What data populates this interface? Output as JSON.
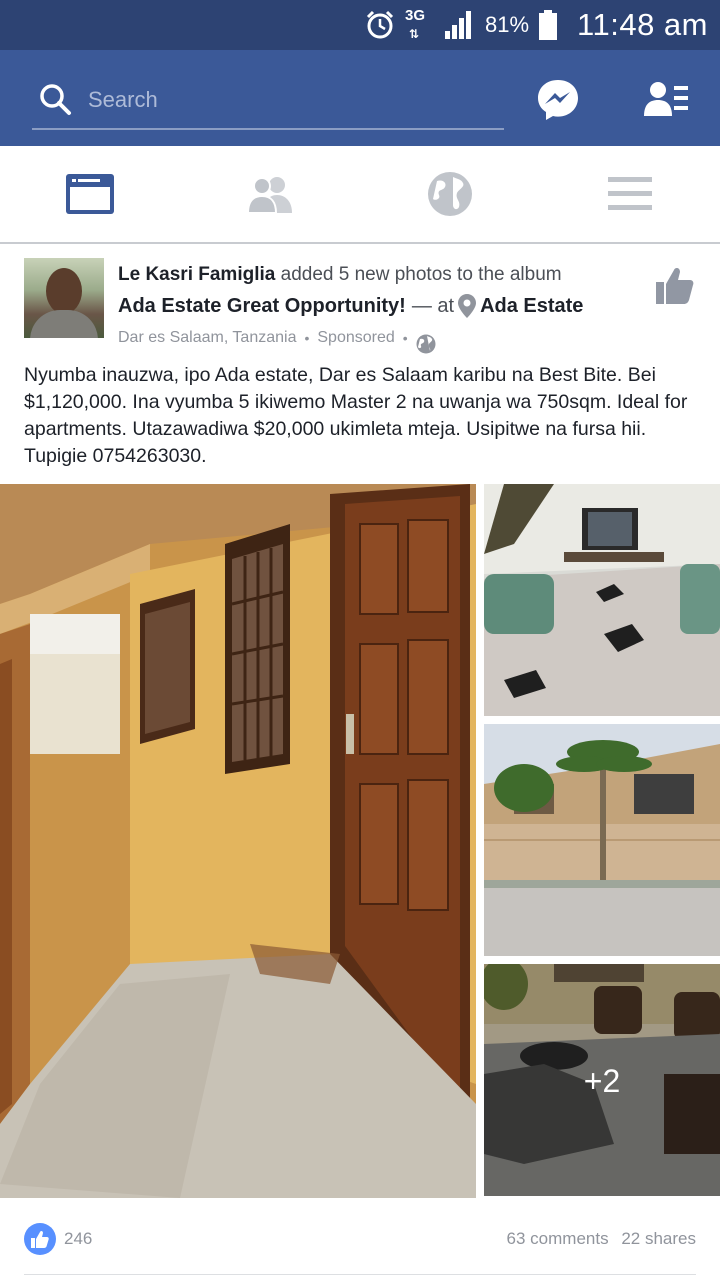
{
  "status_bar": {
    "network": "3G",
    "battery": "81%",
    "time": "11:48 am"
  },
  "app_bar": {
    "search_placeholder": "Search",
    "icons": [
      "search-icon",
      "messenger-icon",
      "friend-requests-icon"
    ]
  },
  "tabs": [
    {
      "name": "news-feed",
      "icon": "news-feed-icon",
      "active": true
    },
    {
      "name": "friends",
      "icon": "friends-icon",
      "active": false
    },
    {
      "name": "notifications",
      "icon": "globe-icon",
      "active": false
    },
    {
      "name": "more",
      "icon": "menu-icon",
      "active": false
    }
  ],
  "post": {
    "author": "Le Kasri Famiglia",
    "action": "added 5 new photos to the album",
    "album": "Ada Estate Great Opportunity!",
    "at_text": "— at",
    "place": "Ada Estate",
    "location": "Dar es Salaam, Tanzania",
    "sponsored": "Sponsored",
    "text": "Nyumba inauzwa, ipo Ada estate, Dar es Salaam karibu na Best Bite. Bei $1,120,000. Ina vyumba 5 ikiwemo Master 2 na uwanja wa 750sqm. Ideal for apartments. Utazawadiwa $20,000 ukimleta mteja. Usipitwe na fursa hii. Tupigie 0754263030.",
    "more_photos": "+2",
    "likes": "246",
    "comments": "63 comments",
    "shares": "22 shares"
  },
  "colors": {
    "status_bar": "#2d4373",
    "brand_blue": "#3b5998",
    "like_blue": "#5890ff",
    "muted_text": "#90949c"
  }
}
